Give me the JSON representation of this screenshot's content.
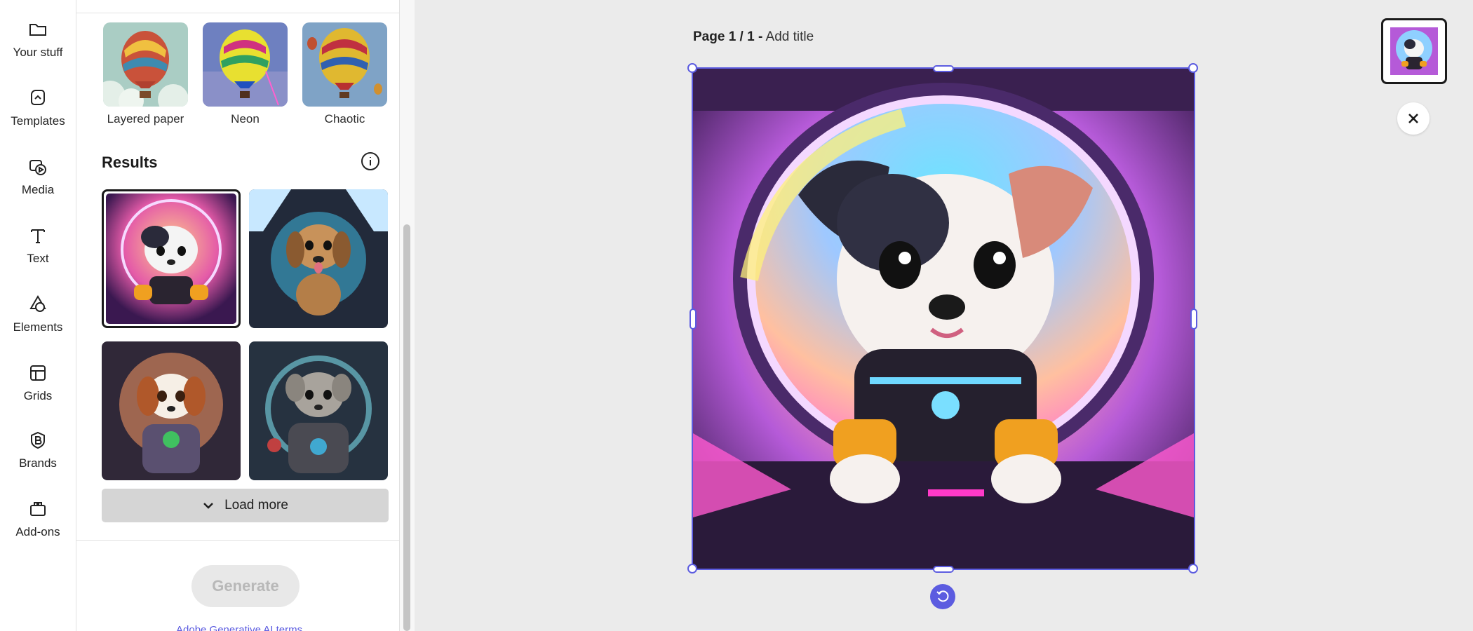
{
  "rail": {
    "items": [
      {
        "label": "Your stuff",
        "icon": "folder-icon"
      },
      {
        "label": "Templates",
        "icon": "templates-icon"
      },
      {
        "label": "Media",
        "icon": "media-icon"
      },
      {
        "label": "Text",
        "icon": "text-icon"
      },
      {
        "label": "Elements",
        "icon": "elements-icon"
      },
      {
        "label": "Grids",
        "icon": "grids-icon"
      },
      {
        "label": "Brands",
        "icon": "brands-icon"
      },
      {
        "label": "Add-ons",
        "icon": "add-ons-icon"
      }
    ]
  },
  "styles": {
    "items": [
      {
        "label": "Layered paper"
      },
      {
        "label": "Neon"
      },
      {
        "label": "Chaotic"
      }
    ]
  },
  "results": {
    "title": "Results",
    "load_more": "Load more"
  },
  "generate": {
    "label": "Generate",
    "terms": "Adobe Generative AI terms"
  },
  "canvas": {
    "page_label": "Page 1 / 1 -",
    "add_title": "Add title"
  },
  "colors": {
    "accent": "#5c5ce0",
    "selection": "#5c5ce0"
  }
}
